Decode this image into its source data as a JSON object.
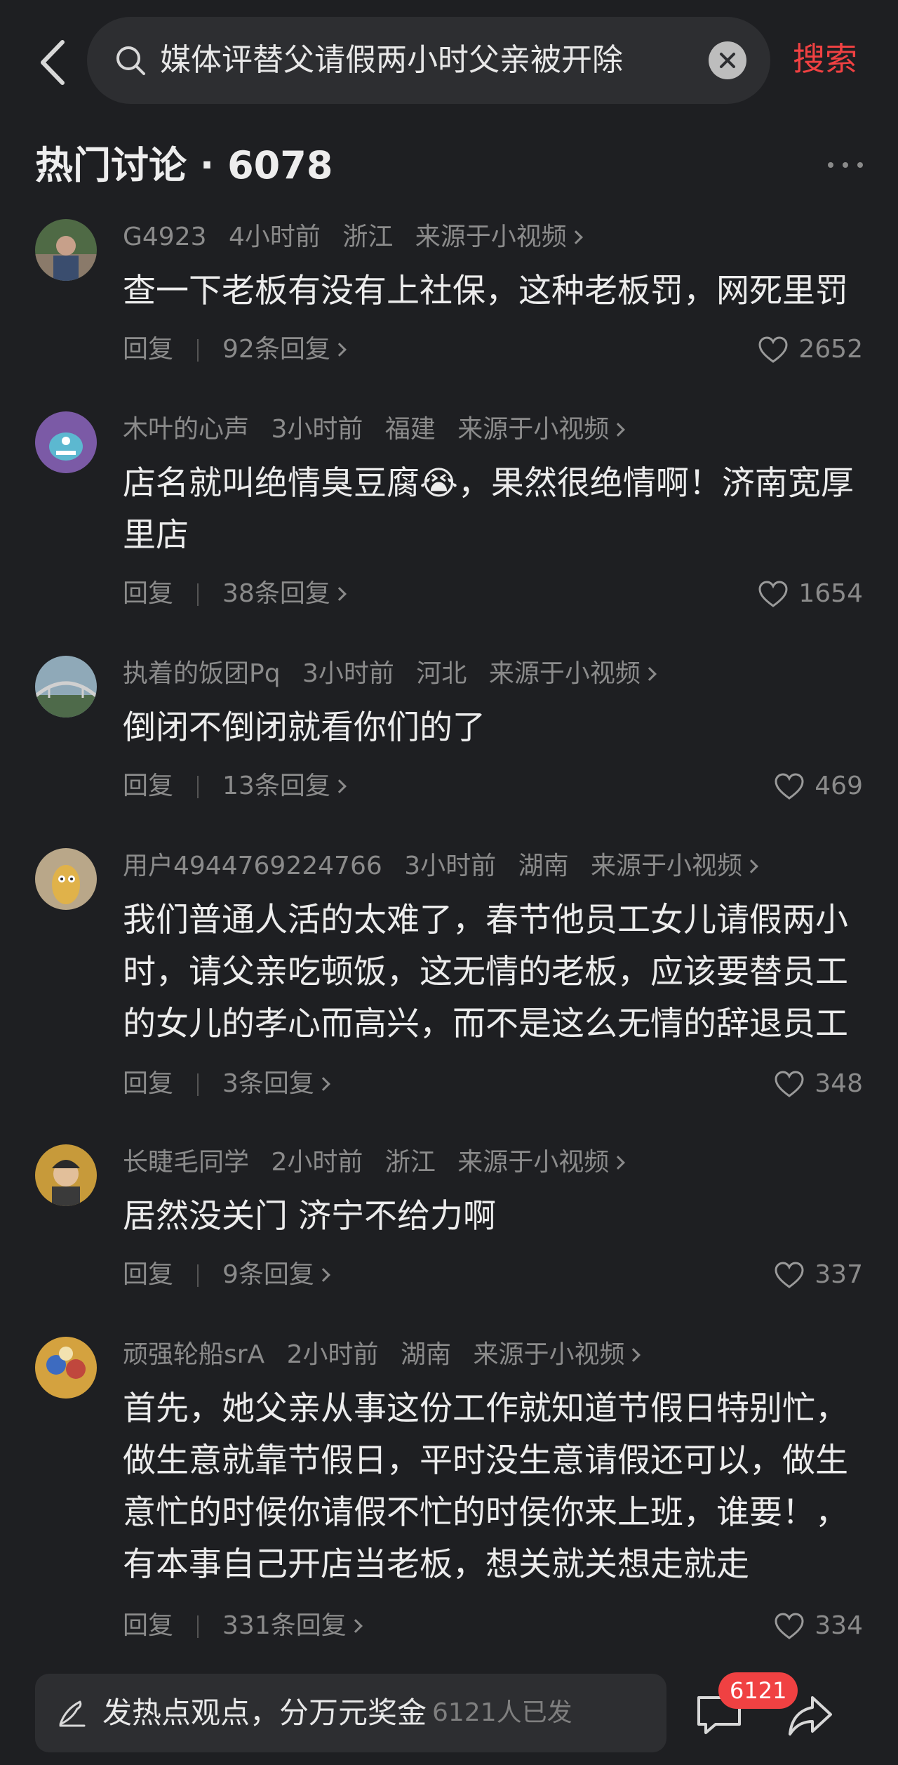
{
  "search": {
    "query": "媒体评替父请假两小时父亲被开除",
    "submit_label": "搜索"
  },
  "section": {
    "title": "热门讨论 · 6078"
  },
  "comments": [
    {
      "user": "G4923",
      "time": "4小时前",
      "location": "浙江",
      "source": "来源于小视频",
      "text": "查一下老板有没有上社保，这种老板罚，网死里罚",
      "reply_label": "回复",
      "replies": "92条回复",
      "likes": "2652",
      "avatar_color": "#6b7f5a"
    },
    {
      "user": "木叶的心声",
      "time": "3小时前",
      "location": "福建",
      "source": "来源于小视频",
      "text": "店名就叫绝情臭豆腐😭，果然很绝情啊！济南宽厚里店",
      "reply_label": "回复",
      "replies": "38条回复",
      "likes": "1654",
      "avatar_color": "#7b5aa6"
    },
    {
      "user": "执着的饭团Pq",
      "time": "3小时前",
      "location": "河北",
      "source": "来源于小视频",
      "text": "倒闭不倒闭就看你们的了",
      "reply_label": "回复",
      "replies": "13条回复",
      "likes": "469",
      "avatar_color": "#5b7a8f"
    },
    {
      "user": "用户4944769224766",
      "time": "3小时前",
      "location": "湖南",
      "source": "来源于小视频",
      "text": "我们普通人活的太难了，春节他员工女儿请假两小时，请父亲吃顿饭，这无情的老板，应该要替员工的女儿的孝心而高兴，而不是这么无情的辞退员工",
      "reply_label": "回复",
      "replies": "3条回复",
      "likes": "348",
      "avatar_color": "#b9a789"
    },
    {
      "user": "长睫毛同学",
      "time": "2小时前",
      "location": "浙江",
      "source": "来源于小视频",
      "text": "居然没关门 济宁不给力啊",
      "reply_label": "回复",
      "replies": "9条回复",
      "likes": "337",
      "avatar_color": "#c79a3a"
    },
    {
      "user": "顽强轮船srA",
      "time": "2小时前",
      "location": "湖南",
      "source": "来源于小视频",
      "text": "首先，她父亲从事这份工作就知道节假日特别忙，做生意就靠节假日，平时没生意请假还可以，做生意忙的时候你请假不忙的时侯你来上班，谁要！，有本事自己开店当老板，想关就关想走就走",
      "reply_label": "回复",
      "replies": "331条回复",
      "likes": "334",
      "avatar_color": "#d4a23f"
    }
  ],
  "bottom": {
    "compose_label": "发热点观点，分万元奖金",
    "compose_sub": "6121人已发",
    "comment_count": "6121"
  },
  "colors": {
    "background": "#1e1f22",
    "accent": "#f04142",
    "secondary_text": "#8b8b8b"
  }
}
